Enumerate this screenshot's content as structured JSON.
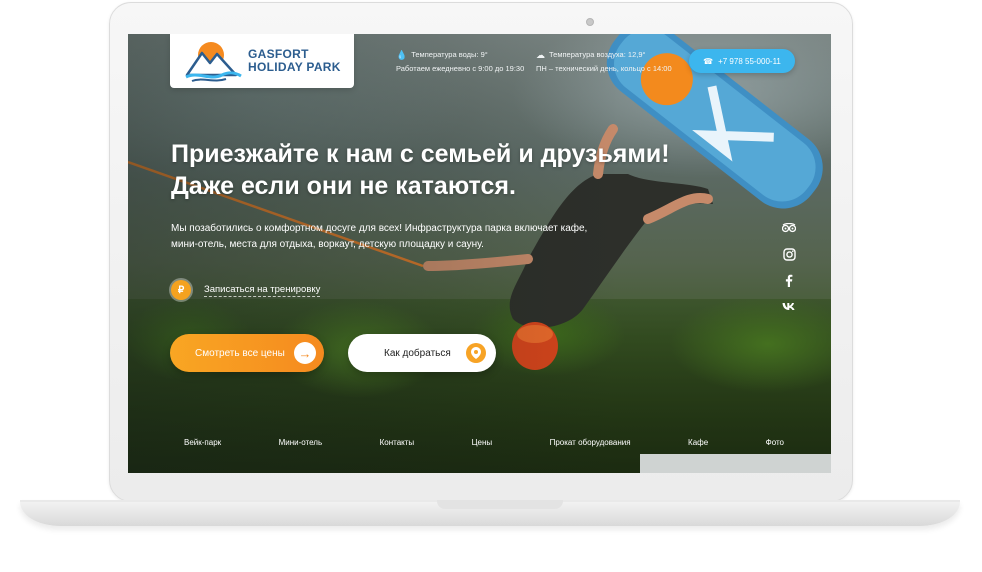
{
  "brand": {
    "line1": "GASFORT",
    "line2": "HOLIDAY PARK",
    "accent": "#f58a1f",
    "primary": "#2c5d8f"
  },
  "header": {
    "water_temp": "Температура воды: 9°",
    "hours": "Работаем ежедневно с 9:00 до 19:30",
    "air_temp": "Температура воздуха: 12,9°",
    "tech_day": "ПН – технический день, кольцо с 14:00",
    "water_icon": "drop-icon",
    "air_icon": "cloud-icon",
    "phone": "+7 978 55-000-11",
    "phone_icon": "phone-icon",
    "phone_color": "#3cb6ee"
  },
  "hero": {
    "title_line1": "Приезжайте к нам с семьей и друзьями!",
    "title_line2": "Даже если они не катаются.",
    "description": "Мы позаботились о комфортном досуге для всех! Инфраструктура парка включает кафе, мини-отель, места для отдыха, воркаут, детскую площадку и сауну.",
    "ruble_symbol": "₽",
    "signup_link": "Записаться на тренировку",
    "prices_button": "Смотреть все цены",
    "route_button": "Как добраться"
  },
  "social": [
    "tripadvisor-icon",
    "instagram-icon",
    "facebook-icon",
    "vk-icon"
  ],
  "nav": [
    "Вейк-парк",
    "Мини-отель",
    "Контакты",
    "Цены",
    "Прокат оборудования",
    "Кафе",
    "Фото"
  ]
}
